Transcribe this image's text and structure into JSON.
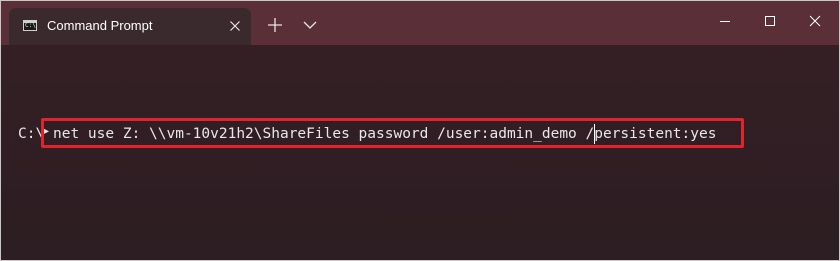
{
  "window": {
    "tab_title": "Command Prompt",
    "tab_icon": "cmd-icon",
    "tab_icon_glyph": "C:\\",
    "controls": {
      "close_tab_icon": "close-icon",
      "new_tab_icon": "plus-icon",
      "dropdown_icon": "chevron-down-icon",
      "minimize_icon": "minimize-icon",
      "maximize_icon": "maximize-icon",
      "close_icon": "close-icon"
    }
  },
  "terminal": {
    "prompt": "C:\\",
    "command": "net use Z: \\\\vm-10v21h2\\ShareFiles password /user:admin_demo /persistent:yes"
  },
  "colors": {
    "titlebar": "#5b2f37",
    "tab": "#3a292d",
    "terminal_background": "#2c1e22",
    "text": "#e8e8e8",
    "highlight": "#e0242e"
  }
}
